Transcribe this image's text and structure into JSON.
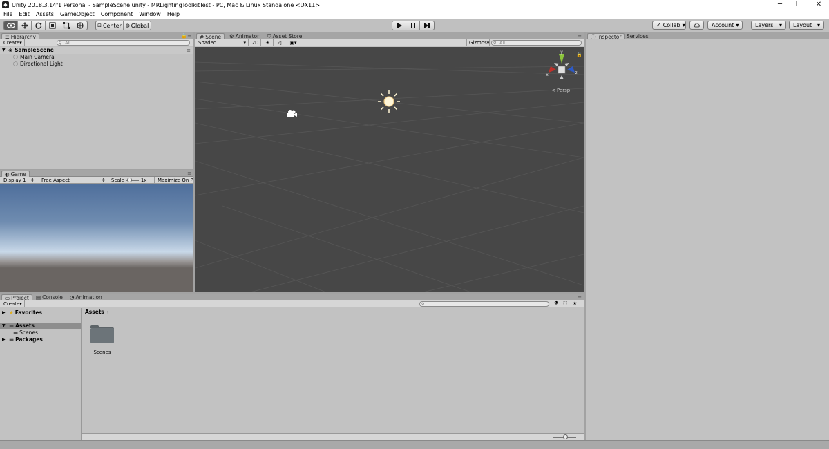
{
  "window": {
    "title": "Unity 2018.3.14f1 Personal - SampleScene.unity - MRLightingToolkitTest - PC, Mac & Linux Standalone <DX11>",
    "app_icon": "unity-icon",
    "controls": {
      "minimize": "─",
      "maximize": "❐",
      "close": "✕"
    }
  },
  "menu": [
    "File",
    "Edit",
    "Assets",
    "GameObject",
    "Component",
    "Window",
    "Help"
  ],
  "toolbar": {
    "pivot": "Center",
    "space": "Global",
    "collab": "Collab",
    "account": "Account",
    "layers": "Layers",
    "layout": "Layout",
    "dropdown_arrow": "▾"
  },
  "hierarchy": {
    "tab": "Hierarchy",
    "create": "Create",
    "search_placeholder": "All",
    "scene": "SampleScene",
    "objects": [
      "Main Camera",
      "Directional Light"
    ]
  },
  "game": {
    "tab": "Game",
    "display": "Display 1",
    "aspect": "Free Aspect",
    "scale_label": "Scale",
    "scale_value": "1x",
    "maximize": "Maximize On Pla",
    "colors": {
      "sky_top": "#4f6f9c",
      "horizon": "#c8d8e8",
      "ground": "#6a6562"
    }
  },
  "scene_view": {
    "tabs": [
      "Scene",
      "Animator",
      "Asset Store"
    ],
    "shading": "Shaded",
    "mode_2d": "2D",
    "gizmos": "Gizmos",
    "search_placeholder": "All",
    "projection": "Persp",
    "axes": {
      "x": "x",
      "y": "y",
      "z": "z"
    },
    "background": "#474747",
    "axis_colors": {
      "x": "#c0302a",
      "y": "#8cc43c",
      "z": "#2d5ac8"
    }
  },
  "inspector": {
    "tabs": [
      "Inspector",
      "Services"
    ]
  },
  "project": {
    "tabs": [
      "Project",
      "Console",
      "Animation"
    ],
    "create": "Create",
    "tree": {
      "favorites": "Favorites",
      "assets": "Assets",
      "scenes": "Scenes",
      "packages": "Packages"
    },
    "breadcrumb": "Assets",
    "breadcrumb_sep": "›",
    "items": [
      {
        "name": "Scenes",
        "icon": "folder-icon"
      }
    ]
  }
}
